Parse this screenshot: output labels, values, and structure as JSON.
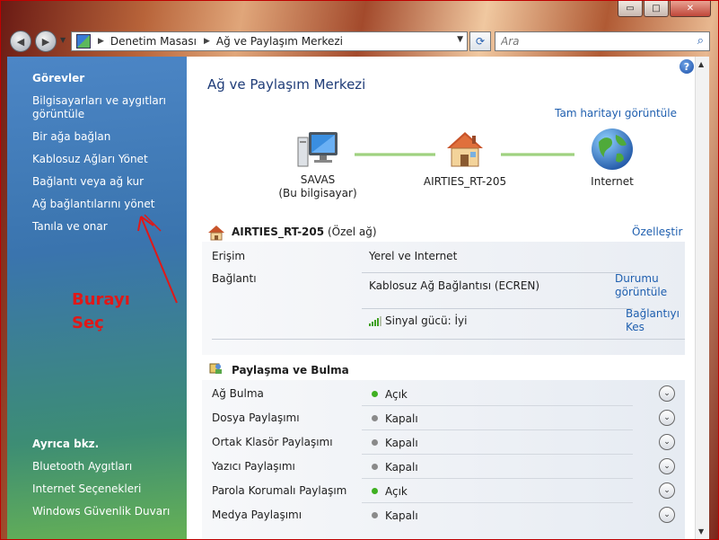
{
  "window": {
    "minimize_glyph": "▭",
    "maximize_glyph": "□",
    "close_glyph": "✕"
  },
  "addressbar": {
    "breadcrumbs": [
      "Denetim Masası",
      "Ağ ve Paylaşım Merkezi"
    ],
    "search_placeholder": "Ara"
  },
  "sidebar": {
    "tasks_title": "Görevler",
    "tasks": [
      "Bilgisayarları ve aygıtları görüntüle",
      "Bir ağa bağlan",
      "Kablosuz Ağları Yönet",
      "Bağlantı veya ağ kur",
      "Ağ bağlantılarını yönet",
      "Tanıla ve onar"
    ],
    "see_also_title": "Ayrıca bkz.",
    "see_also": [
      "Bluetooth Aygıtları",
      "Internet Seçenekleri",
      "Windows Güvenlik Duvarı"
    ]
  },
  "annotation": {
    "line1": "Burayı",
    "line2": "Seç",
    "color": "#e01818"
  },
  "content": {
    "page_title": "Ağ ve Paylaşım Merkezi",
    "full_map_link": "Tam haritayı görüntüle",
    "map_nodes": {
      "computer_name": "SAVAS",
      "computer_sub": "(Bu bilgisayar)",
      "network_name": "AIRTIES_RT-205",
      "internet": "Internet"
    },
    "network": {
      "name": "AIRTIES_RT-205",
      "type": "(Özel ağ)",
      "customize_link": "Özelleştir",
      "access_label": "Erişim",
      "access_value": "Yerel ve Internet",
      "connection_label": "Bağlantı",
      "connection_value": "Kablosuz Ağ Bağlantısı (ECREN)",
      "view_status_link": "Durumu görüntüle",
      "signal_label": "Sinyal gücü:",
      "signal_value": "İyi",
      "disconnect_link": "Bağlantıyı Kes"
    },
    "sharing": {
      "title": "Paylaşma ve Bulma",
      "rows": [
        {
          "name": "Ağ Bulma",
          "status": "Açık",
          "on": true
        },
        {
          "name": "Dosya Paylaşımı",
          "status": "Kapalı",
          "on": false
        },
        {
          "name": "Ortak Klasör Paylaşımı",
          "status": "Kapalı",
          "on": false
        },
        {
          "name": "Yazıcı Paylaşımı",
          "status": "Kapalı",
          "on": false
        },
        {
          "name": "Parola Korumalı Paylaşım",
          "status": "Açık",
          "on": true
        },
        {
          "name": "Medya Paylaşımı",
          "status": "Kapalı",
          "on": false
        }
      ]
    },
    "colors": {
      "status_on": "#3fb021",
      "status_off": "#8a8a8a",
      "link": "#1f5faf"
    }
  }
}
